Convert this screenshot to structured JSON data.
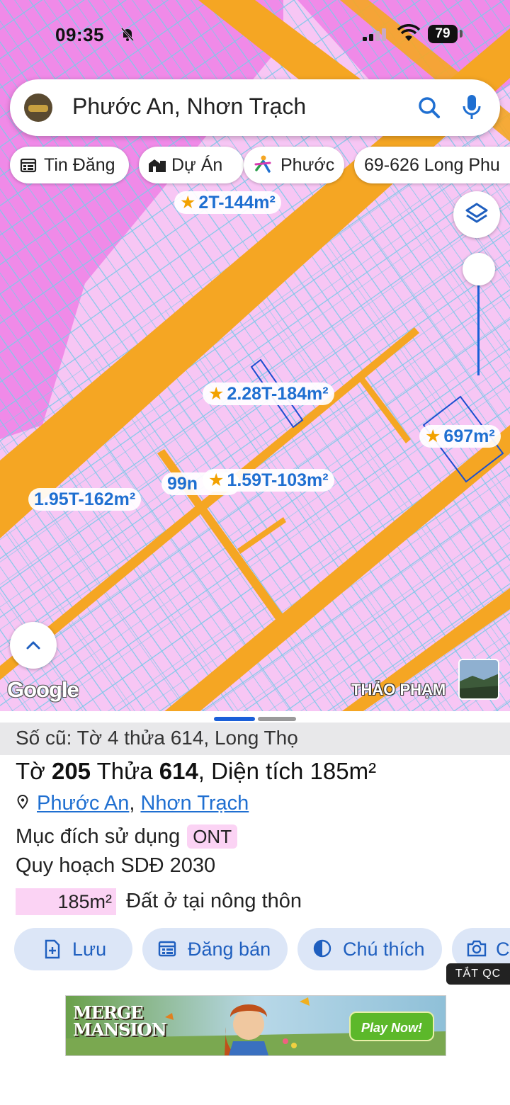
{
  "status_bar": {
    "time": "09:35",
    "battery": "79"
  },
  "search": {
    "text": "Phước An, Nhơn Trạch"
  },
  "chips": [
    {
      "label": "Tin Đăng",
      "icon": "calendar-icon"
    },
    {
      "label": "Dự Án",
      "icon": "buildings-icon"
    },
    {
      "label": "Phước",
      "icon": "person-logo-icon"
    },
    {
      "label": "69-626 Long Phu",
      "icon": ""
    }
  ],
  "map_labels": {
    "l1": {
      "star": "★",
      "text": "2T-144m²"
    },
    "l2": {
      "star": "★",
      "text": "2.28T-184m²"
    },
    "l3": {
      "star": "★",
      "text": "697m²"
    },
    "l4": {
      "star": "★",
      "text": "1.59T-103m²"
    },
    "l5": {
      "text": "1.95T-162m²"
    },
    "l6": {
      "text": "99n"
    }
  },
  "map": {
    "google": "Google",
    "watermark": "THẢO PHẠM"
  },
  "sheet": {
    "old_info": "Số cũ: Tờ 4 thửa 614, Long Thọ",
    "parcel_prefix": "Tờ ",
    "sheet_no": "205",
    "parcel_mid": " Thửa ",
    "parcel_no": "614",
    "area_text": ", Diện tích 185m²",
    "ward": "Phước An",
    "sep": ", ",
    "district": "Nhơn Trạch",
    "purpose_label": "Mục đích sử dụng",
    "purpose_code": "ONT",
    "plan_label": "Quy hoạch SDĐ 2030",
    "legend_area": "185m²",
    "legend_desc": "Đất ở tại nông thôn"
  },
  "actions": [
    {
      "label": "Lưu",
      "icon": "add-file-icon"
    },
    {
      "label": "Đăng bán",
      "icon": "calendar-icon"
    },
    {
      "label": "Chú thích",
      "icon": "contrast-icon"
    },
    {
      "label": "C",
      "icon": "camera-icon"
    }
  ],
  "ad": {
    "off_label": "TẮT QC",
    "title_line1": "MERGE",
    "title_line2": "MANSION",
    "cta": "Play Now!"
  },
  "colors": {
    "accent": "#1f6fd1",
    "road": "#f5a623",
    "land": "#f5c4f2",
    "parcel_lines": "#6fc9e8"
  }
}
